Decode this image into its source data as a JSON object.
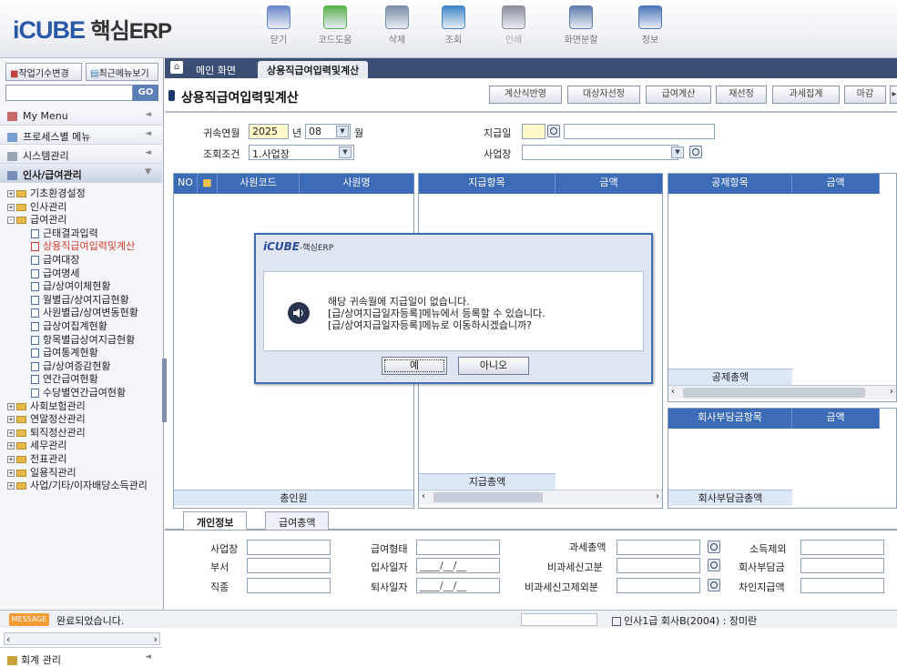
{
  "app": {
    "logo_brand": "iCUBE",
    "logo_suffix": "핵심ERP"
  },
  "toolbar": [
    {
      "label": "닫기",
      "icon": "close-icon",
      "disabled": false
    },
    {
      "label": "코드도움",
      "icon": "code-help-icon",
      "disabled": false
    },
    {
      "label": "삭제",
      "icon": "trash-icon",
      "disabled": false
    },
    {
      "label": "조회",
      "icon": "search-icon",
      "disabled": false
    },
    {
      "label": "인쇄",
      "icon": "printer-icon",
      "disabled": true
    },
    {
      "label": "화면분할",
      "icon": "split-screen-icon",
      "disabled": false
    },
    {
      "label": "정보",
      "icon": "info-icon",
      "disabled": false
    }
  ],
  "sidebar": {
    "btn_change": "작업기수변경",
    "btn_recent": "최근메뉴보기",
    "go": "GO",
    "menus": [
      "My Menu",
      "프로세스별 메뉴",
      "시스템관리",
      "인사/급여관리"
    ],
    "tree": [
      {
        "label": "기초환경설정",
        "type": "folder",
        "pm": "+",
        "indent": 0
      },
      {
        "label": "인사관리",
        "type": "folder",
        "pm": "+",
        "indent": 0
      },
      {
        "label": "급여관리",
        "type": "folder",
        "pm": "-",
        "indent": 0
      },
      {
        "label": "근태결과입력",
        "type": "doc",
        "indent": 1
      },
      {
        "label": "상용직급여입력및계산",
        "type": "doc",
        "indent": 1,
        "selected": true
      },
      {
        "label": "급여대장",
        "type": "doc",
        "indent": 1
      },
      {
        "label": "급여명세",
        "type": "doc",
        "indent": 1
      },
      {
        "label": "급/상여이체현황",
        "type": "doc",
        "indent": 1
      },
      {
        "label": "월별급/상여지급현황",
        "type": "doc",
        "indent": 1
      },
      {
        "label": "사원별급/상여변동현황",
        "type": "doc",
        "indent": 1
      },
      {
        "label": "급상여집계현황",
        "type": "doc",
        "indent": 1
      },
      {
        "label": "항목별급상여지급현황",
        "type": "doc",
        "indent": 1
      },
      {
        "label": "급여통계현황",
        "type": "doc",
        "indent": 1
      },
      {
        "label": "급/상여증감현황",
        "type": "doc",
        "indent": 1
      },
      {
        "label": "연간급여현황",
        "type": "doc",
        "indent": 1
      },
      {
        "label": "수당별연간급여현황",
        "type": "doc",
        "indent": 1
      },
      {
        "label": "사회보험관리",
        "type": "folder",
        "pm": "+",
        "indent": 0
      },
      {
        "label": "연말정산관리",
        "type": "folder",
        "pm": "+",
        "indent": 0
      },
      {
        "label": "퇴직정산관리",
        "type": "folder",
        "pm": "+",
        "indent": 0
      },
      {
        "label": "세무관리",
        "type": "folder",
        "pm": "+",
        "indent": 0
      },
      {
        "label": "전표관리",
        "type": "folder",
        "pm": "+",
        "indent": 0
      },
      {
        "label": "일용직관리",
        "type": "folder",
        "pm": "+",
        "indent": 0
      },
      {
        "label": "사업/기타/이자배당소득관리",
        "type": "folder",
        "pm": "+",
        "indent": 0
      }
    ],
    "bottom_menu": "회계 관리"
  },
  "tabs": {
    "home": "메인 화면",
    "active": "상용직급여입력및계산"
  },
  "page": {
    "title": "상용직급여입력및계산",
    "actions": [
      "계산식반영",
      "대상자선정",
      "급여계산",
      "재선정",
      "과세집계",
      "마감"
    ]
  },
  "conditions": {
    "period_label": "귀속연월",
    "year": "2025",
    "year_unit": "년",
    "month": "08",
    "month_unit": "월",
    "query_label": "조회조건",
    "query_value": "1.사업장",
    "payday_label": "지급일",
    "site_label": "사업장"
  },
  "grid1": {
    "headers": [
      "NO",
      "",
      "사원코드",
      "사원명"
    ],
    "total_label": "총인원"
  },
  "grid2": {
    "headers": [
      "지급항목",
      "금액"
    ],
    "total_label": "지급총액"
  },
  "grid3": {
    "headers": [
      "공제항목",
      "금액"
    ],
    "total_label": "공제총액"
  },
  "grid4": {
    "headers": [
      "회사부담금항목",
      "금액"
    ],
    "total_label": "회사부담금총액"
  },
  "bottom_tabs": [
    "개인정보",
    "급여총액"
  ],
  "info": {
    "col1": [
      "사업장",
      "부서",
      "직종"
    ],
    "col2": [
      "급여형태",
      "입사일자",
      "퇴사일자"
    ],
    "date_placeholder": "____/__/__",
    "col3": [
      "과세총액",
      "비과세신고분",
      "비과세신고제외분"
    ],
    "col4": [
      "소득제외",
      "회사부담금",
      "차인지급액"
    ]
  },
  "status": {
    "message_tag": "MESSAGE",
    "message": "완료되었습니다.",
    "user_info": "인사1급 회사B(2004) : 장미란"
  },
  "dialog": {
    "title_brand": "iCUBE",
    "title_suffix": "-핵심ERP",
    "line1": "해당 귀속월에 지급일이 없습니다.",
    "line2": "[급/상여지급일자등록]메뉴에서 등록할 수 있습니다.",
    "line3": "[급/상여지급일자등록]메뉴로 이동하시겠습니까?",
    "yes": "예",
    "no": "아니오"
  },
  "colors": {
    "header_blue": "#3c6bb7",
    "tab_dark": "#3a4f73",
    "selected_red": "#d23a2a"
  }
}
